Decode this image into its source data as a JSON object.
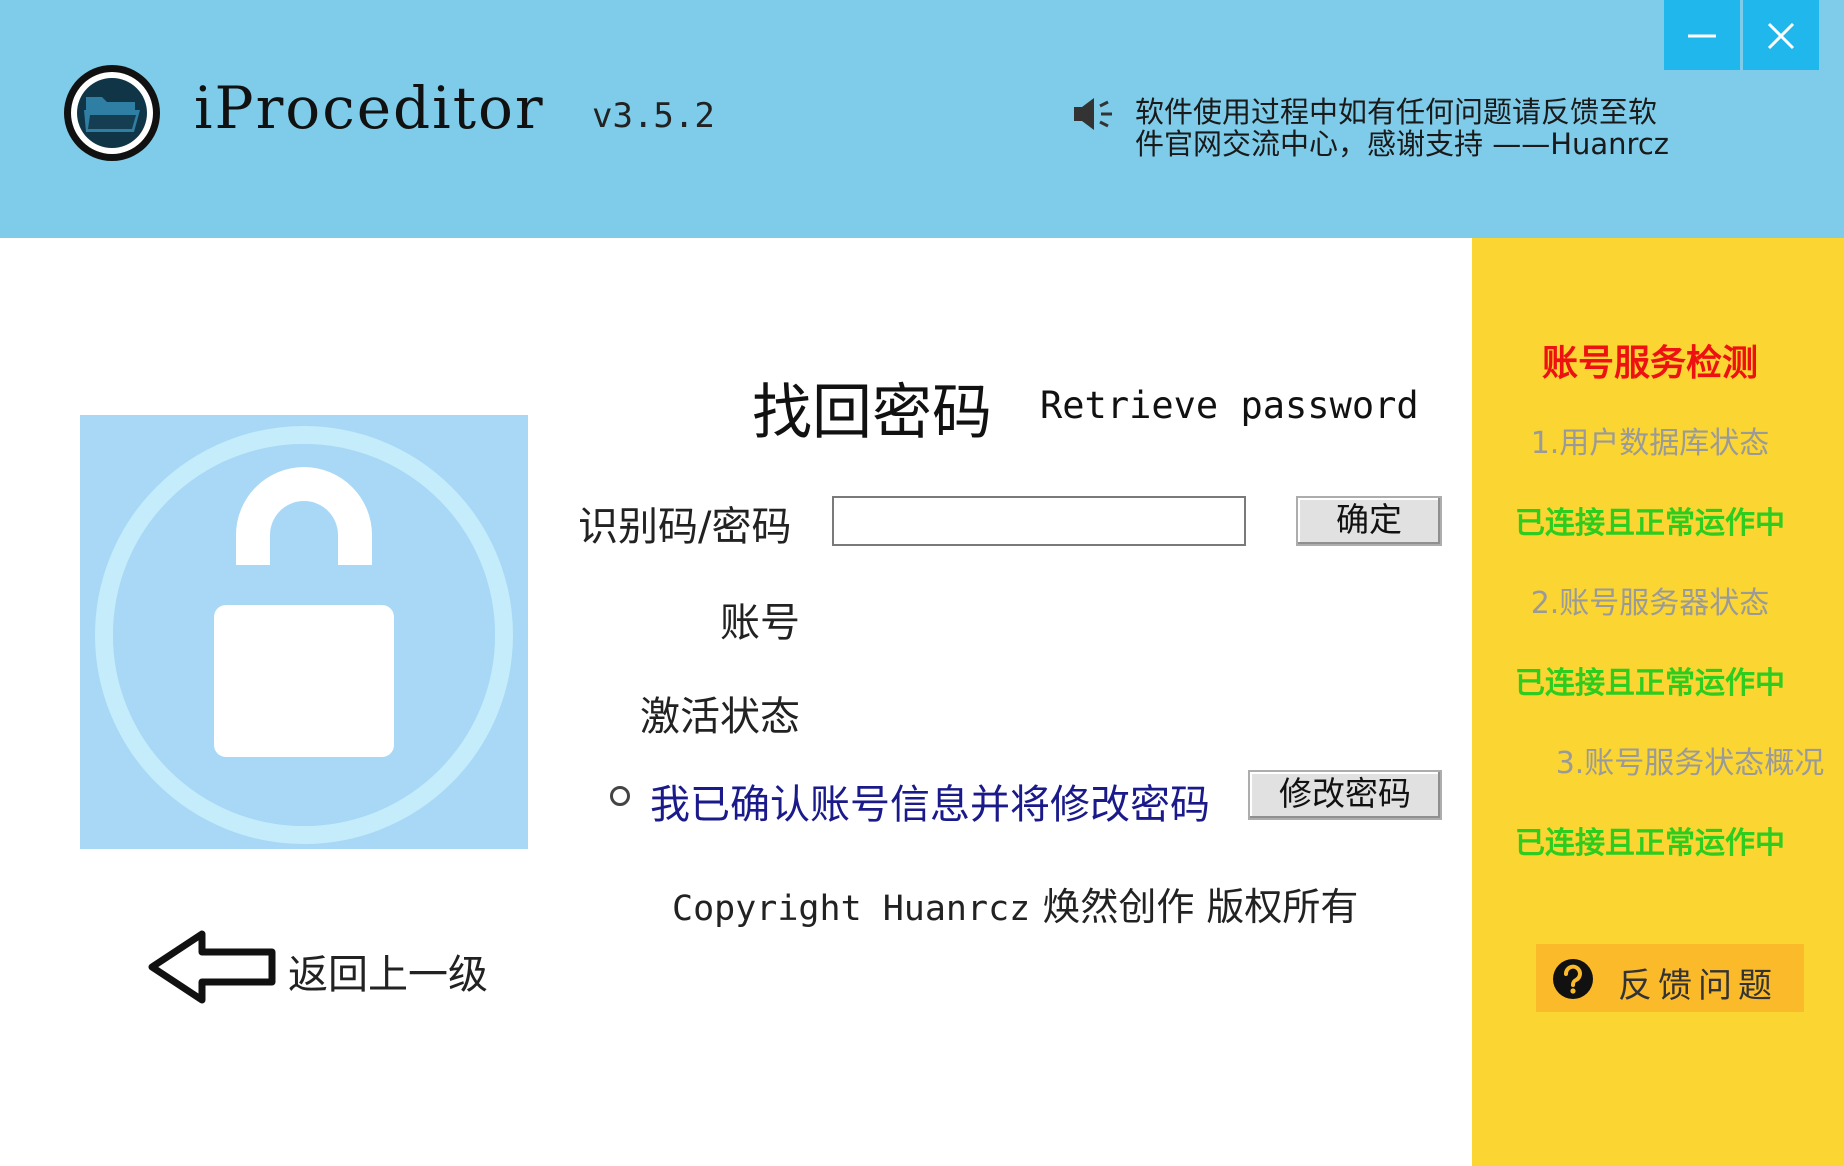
{
  "header": {
    "app_name": "iProceditor",
    "version": "v3.5.2",
    "notice_line1": "软件使用过程中如有任何问题请反馈至软",
    "notice_line2": "件官网交流中心，感谢支持 ——Huanrcz",
    "window_controls": {
      "minimize_icon": "minimize-icon",
      "close_icon": "close-icon"
    }
  },
  "form": {
    "title_cn": "找回密码",
    "title_en": "Retrieve password",
    "code_label": "识别码/密码",
    "code_value": "",
    "confirm_button": "确定",
    "account_label": "账号",
    "status_label": "激活状态",
    "confirm_radio_label": "我已确认账号信息并将修改密码",
    "change_password_button": "修改密码",
    "copyright_en": "Copyright Huanrcz",
    "copyright_cn": "焕然创作 版权所有"
  },
  "nav": {
    "back_label": "返回上一级"
  },
  "sidebar": {
    "title": "账号服务检测",
    "items": [
      {
        "label": "1.用户数据库状态",
        "status": "已连接且正常运作中"
      },
      {
        "label": "2.账号服务器状态",
        "status": "已连接且正常运作中"
      },
      {
        "label": "3.账号服务状态概况",
        "status": "已连接且正常运作中"
      }
    ],
    "feedback_button": "反馈问题"
  },
  "colors": {
    "header_bg": "#7ecce9",
    "window_button_bg": "#1fb7ec",
    "sidebar_bg": "#fbd532",
    "sidebar_title": "#ee1111",
    "status_ok": "#2dcc1e",
    "feedback_bg": "#fbba2a",
    "lock_tile_bg": "#a8d8f6"
  }
}
